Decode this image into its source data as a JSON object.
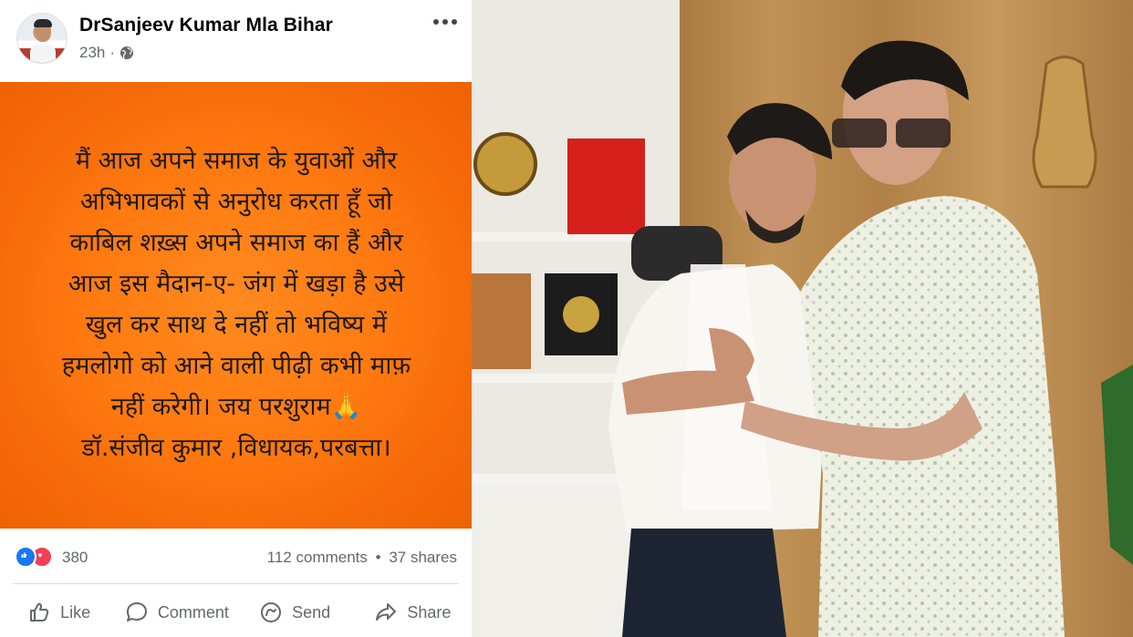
{
  "post": {
    "author": "DrSanjeev Kumar Mla Bihar",
    "time": "23h",
    "privacy_icon": "globe-icon",
    "more_icon": "more-options-icon",
    "image_text_lines": [
      "मैं आज अपने समाज के युवाओं और",
      "अभिभावकों से अनुरोध करता हूँ जो",
      "काबिल शख़्स अपने समाज का हैं और",
      "आज इस मैदान-ए- जंग में खड़ा है उसे",
      "खुल कर साथ दे नहीं तो भविष्य में",
      "हमलोगो को आने वाली पीढ़ी कभी माफ़",
      "नहीं करेगी। जय परशुराम🙏",
      "डॉ.संजीव कुमार ,विधायक,परबत्ता।"
    ],
    "background_color": "#ff7a10"
  },
  "reactions": {
    "count": "380",
    "comments": "112 comments",
    "separator": "•",
    "shares": "37 shares"
  },
  "actions": {
    "like": "Like",
    "comment": "Comment",
    "send": "Send",
    "share": "Share"
  },
  "colors": {
    "fb_blue": "#1877f2",
    "love_red": "#f33e58",
    "secondary_text": "#65676b"
  }
}
